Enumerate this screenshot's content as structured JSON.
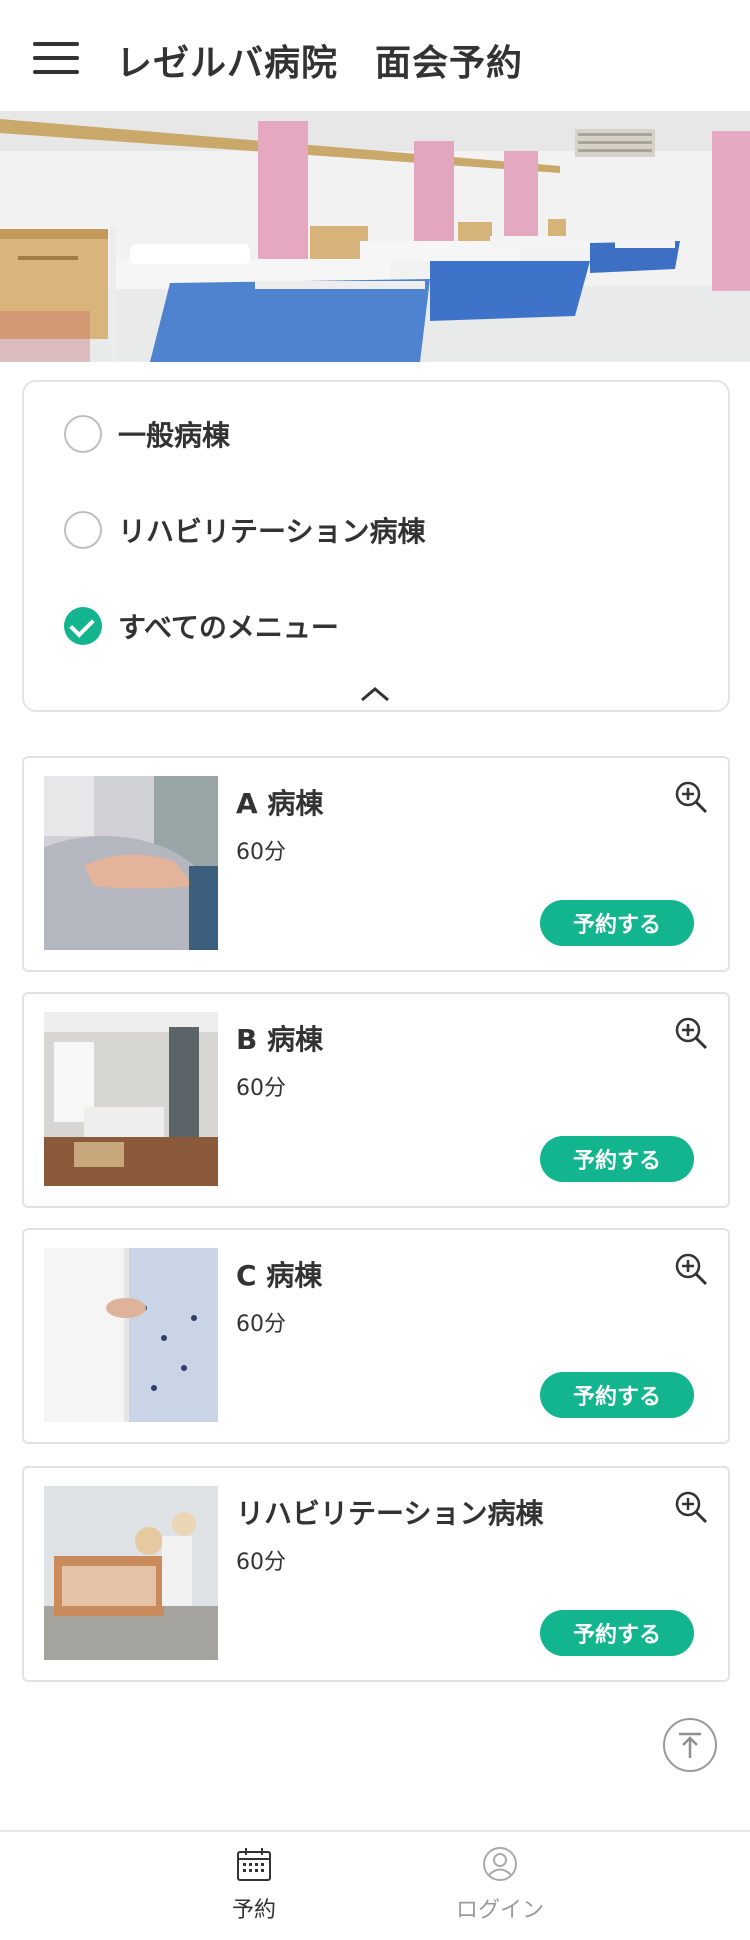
{
  "header": {
    "title": "レゼルバ病院　面会予約"
  },
  "filter": {
    "options": [
      {
        "label": "一般病棟",
        "checked": false
      },
      {
        "label": "リハビリテーション病棟",
        "checked": false
      },
      {
        "label": "すべてのメニュー",
        "checked": true
      }
    ]
  },
  "cards": [
    {
      "title": "A 病棟",
      "duration": "60分",
      "button": "予約する"
    },
    {
      "title": "B 病棟",
      "duration": "60分",
      "button": "予約する"
    },
    {
      "title": "C 病棟",
      "duration": "60分",
      "button": "予約する"
    },
    {
      "title": "リハビリテーション病棟",
      "duration": "60分",
      "button": "予約する"
    }
  ],
  "bottom_nav": [
    {
      "label": "予約",
      "icon": "calendar-icon",
      "active": true
    },
    {
      "label": "ログイン",
      "icon": "user-icon",
      "active": false
    }
  ],
  "colors": {
    "accent": "#12b58e",
    "text": "#333333",
    "border": "#e2e2e2",
    "inactive": "#9a9a9a"
  }
}
